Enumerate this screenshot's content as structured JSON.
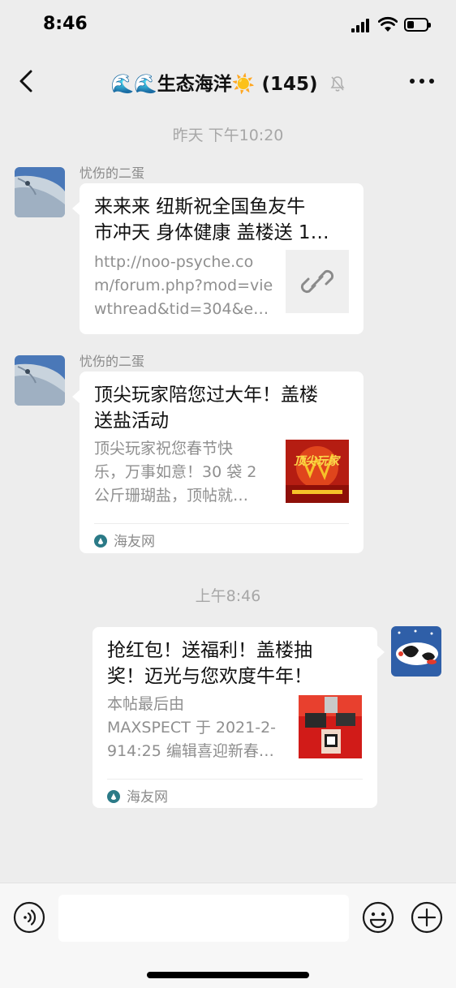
{
  "status_bar": {
    "time": "8:46"
  },
  "header": {
    "title_emoji": "🌊🌊",
    "title": "生态海洋",
    "title_sun": "☀️",
    "member_count": "(145)"
  },
  "messages": [
    {
      "timestamp": "昨天 下午10:20",
      "sender": "忧伤的二蛋",
      "title_line1": "来来来 纽斯祝全国鱼友牛",
      "title_line2": "市冲天 身体健康 盖楼送 1…",
      "desc_line1": "http://noo-psyche.co",
      "desc_line2": "m/forum.php?mod=vie",
      "desc_line3": "wthread&tid=304&e…",
      "thumb_icon": "link-icon"
    },
    {
      "sender": "忧伤的二蛋",
      "title_line1": "顶尖玩家陪您过大年！盖楼",
      "title_line2": "送盐活动",
      "desc_line1": "顶尖玩家祝您春节快",
      "desc_line2": "乐，万事如意！30 袋 2",
      "desc_line3": "公斤珊瑚盐，顶帖就…",
      "thumb_text": "顶尖玩家",
      "source": "海友网"
    },
    {
      "timestamp": "上午8:46",
      "title_line1": "抢红包！送福利！盖楼抽",
      "title_line2": "奖！迈光与您欢度牛年！",
      "desc_line1": "本帖最后由",
      "desc_line2": "MAXSPECT 于 2021-2-",
      "desc_line3": "914:25 编辑喜迎新春…",
      "source": "海友网"
    }
  ],
  "input_bar": {
    "placeholder": ""
  },
  "colors": {
    "background": "#ededed",
    "bubble": "#ffffff",
    "timestamp": "#a7a7a7",
    "source_icon": "#2b7a87"
  }
}
